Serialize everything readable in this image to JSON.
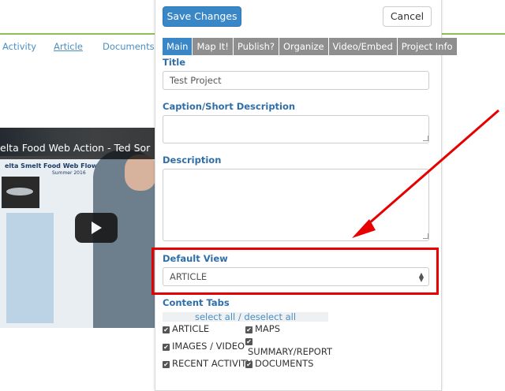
{
  "background_nav": {
    "items": [
      "Activity",
      "Article",
      "Documents"
    ]
  },
  "video": {
    "title": "elta Food Web Action - Ted Sor",
    "poster_heading": "elta Smelt Food Web Flow Action",
    "poster_subheading": "Summer 2016"
  },
  "toolbar": {
    "save_label": "Save Changes",
    "cancel_label": "Cancel"
  },
  "tabs": [
    {
      "label": "Main",
      "active": true
    },
    {
      "label": "Map It!",
      "active": false
    },
    {
      "label": "Publish?",
      "active": false
    },
    {
      "label": "Organize",
      "active": false
    },
    {
      "label": "Video/Embed",
      "active": false
    },
    {
      "label": "Project Info",
      "active": false
    }
  ],
  "form": {
    "title_label": "Title",
    "title_value": "Test Project",
    "caption_label": "Caption/Short Description",
    "caption_value": "",
    "description_label": "Description",
    "description_value": "",
    "default_view_label": "Default View",
    "default_view_value": "ARTICLE",
    "content_tabs_label": "Content Tabs",
    "select_all": "select all",
    "separator": "/",
    "deselect_all": "deselect all"
  },
  "content_tabs": {
    "article": "ARTICLE",
    "maps": "MAPS",
    "images_video": "IMAGES / VIDEO",
    "summary_report": "SUMMARY/REPORT",
    "recent_activity": "RECENT ACTIVITY",
    "documents": "DOCUMENTS",
    "check_glyph": "✔"
  },
  "colors": {
    "accent": "#3a87c8",
    "label": "#2f6ea8",
    "highlight": "#e60000",
    "divider": "#8cc152"
  }
}
